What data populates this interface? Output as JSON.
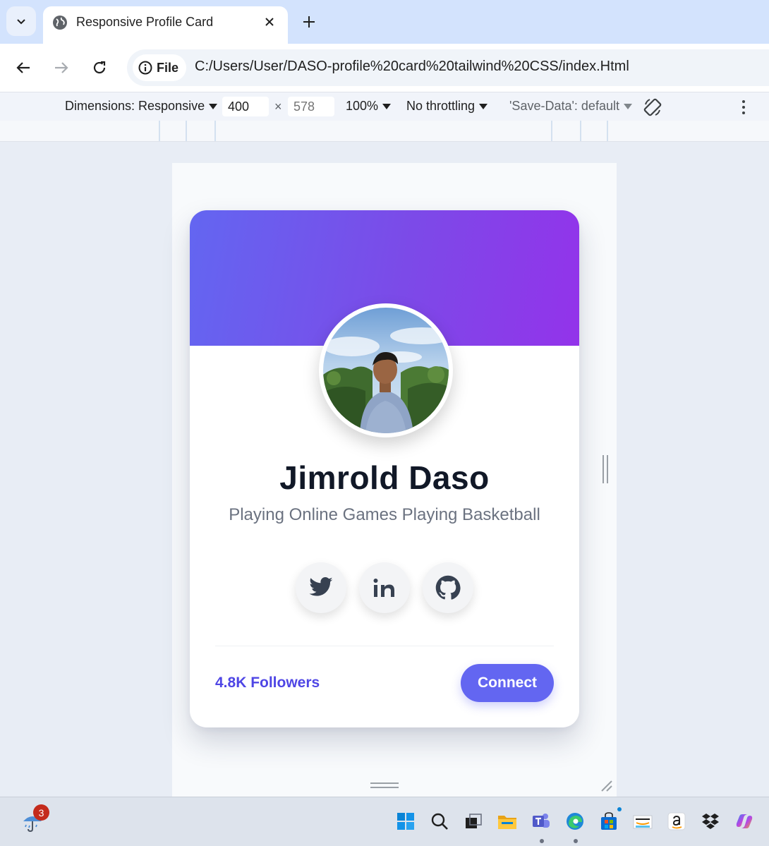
{
  "browser": {
    "tab": {
      "title": "Responsive Profile Card"
    },
    "address": {
      "chip": "File",
      "url": "C:/Users/User/DASO-profile%20card%20tailwind%20CSS/index.Html"
    }
  },
  "devtools": {
    "dimensions_label": "Dimensions: Responsive",
    "width": "400",
    "height": "578",
    "times": "×",
    "zoom": "100%",
    "throttling": "No throttling",
    "save_data": "'Save-Data': default"
  },
  "profile": {
    "name": "Jimrold Daso",
    "bio": "Playing Online Games Playing Basketball",
    "followers": "4.8K Followers",
    "connect_label": "Connect",
    "socials": [
      "twitter",
      "linkedin",
      "github"
    ]
  },
  "taskbar": {
    "weather_badge": "3",
    "apps": [
      "start",
      "search",
      "task-view",
      "file-explorer",
      "teams",
      "edge",
      "microsoft-store",
      "amazon",
      "amazon-alt",
      "dropbox",
      "copilot"
    ]
  },
  "colors": {
    "banner_start": "#6366f1",
    "banner_end": "#9333ea",
    "accent": "#6366f1",
    "followers_text": "#4f46e5"
  }
}
